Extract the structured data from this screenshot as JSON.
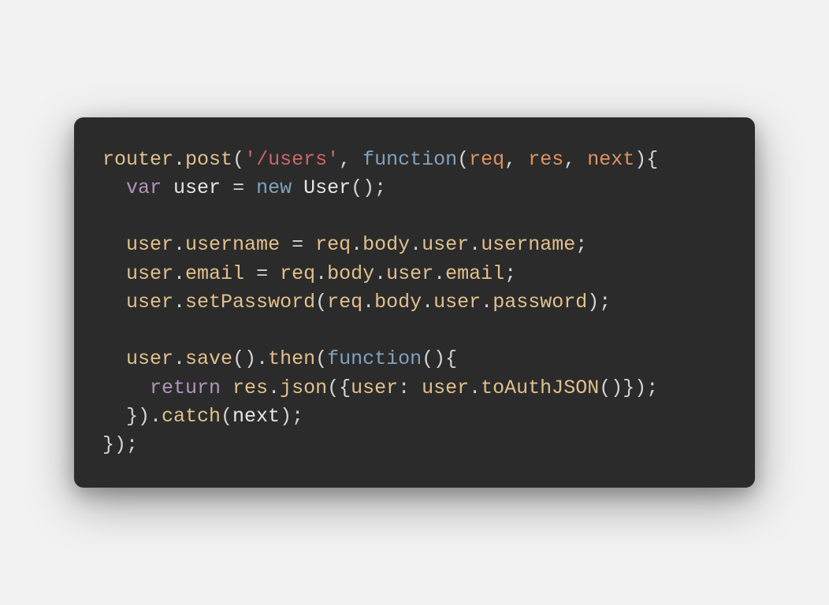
{
  "code": {
    "tokens": [
      [
        {
          "t": "router",
          "c": "tok-object"
        },
        {
          "t": ".",
          "c": "tok-punct"
        },
        {
          "t": "post",
          "c": "tok-method"
        },
        {
          "t": "(",
          "c": "tok-punct"
        },
        {
          "t": "'/users'",
          "c": "tok-string"
        },
        {
          "t": ", ",
          "c": "tok-punct"
        },
        {
          "t": "function",
          "c": "tok-keyword"
        },
        {
          "t": "(",
          "c": "tok-punct"
        },
        {
          "t": "req",
          "c": "tok-param"
        },
        {
          "t": ", ",
          "c": "tok-punct"
        },
        {
          "t": "res",
          "c": "tok-param"
        },
        {
          "t": ", ",
          "c": "tok-punct"
        },
        {
          "t": "next",
          "c": "tok-param"
        },
        {
          "t": "){",
          "c": "tok-punct"
        }
      ],
      [
        {
          "t": "  ",
          "c": "tok-punct"
        },
        {
          "t": "var",
          "c": "tok-var"
        },
        {
          "t": " ",
          "c": "tok-punct"
        },
        {
          "t": "user",
          "c": "tok-ident"
        },
        {
          "t": " = ",
          "c": "tok-punct"
        },
        {
          "t": "new",
          "c": "tok-newkw"
        },
        {
          "t": " ",
          "c": "tok-punct"
        },
        {
          "t": "User",
          "c": "tok-class"
        },
        {
          "t": "();",
          "c": "tok-punct"
        }
      ],
      [
        {
          "t": "",
          "c": "tok-punct"
        }
      ],
      [
        {
          "t": "  ",
          "c": "tok-punct"
        },
        {
          "t": "user",
          "c": "tok-object"
        },
        {
          "t": ".",
          "c": "tok-punct"
        },
        {
          "t": "username",
          "c": "tok-prop"
        },
        {
          "t": " = ",
          "c": "tok-punct"
        },
        {
          "t": "req",
          "c": "tok-object"
        },
        {
          "t": ".",
          "c": "tok-punct"
        },
        {
          "t": "body",
          "c": "tok-prop"
        },
        {
          "t": ".",
          "c": "tok-punct"
        },
        {
          "t": "user",
          "c": "tok-prop"
        },
        {
          "t": ".",
          "c": "tok-punct"
        },
        {
          "t": "username",
          "c": "tok-prop"
        },
        {
          "t": ";",
          "c": "tok-punct"
        }
      ],
      [
        {
          "t": "  ",
          "c": "tok-punct"
        },
        {
          "t": "user",
          "c": "tok-object"
        },
        {
          "t": ".",
          "c": "tok-punct"
        },
        {
          "t": "email",
          "c": "tok-prop"
        },
        {
          "t": " = ",
          "c": "tok-punct"
        },
        {
          "t": "req",
          "c": "tok-object"
        },
        {
          "t": ".",
          "c": "tok-punct"
        },
        {
          "t": "body",
          "c": "tok-prop"
        },
        {
          "t": ".",
          "c": "tok-punct"
        },
        {
          "t": "user",
          "c": "tok-prop"
        },
        {
          "t": ".",
          "c": "tok-punct"
        },
        {
          "t": "email",
          "c": "tok-prop"
        },
        {
          "t": ";",
          "c": "tok-punct"
        }
      ],
      [
        {
          "t": "  ",
          "c": "tok-punct"
        },
        {
          "t": "user",
          "c": "tok-object"
        },
        {
          "t": ".",
          "c": "tok-punct"
        },
        {
          "t": "setPassword",
          "c": "tok-method"
        },
        {
          "t": "(",
          "c": "tok-punct"
        },
        {
          "t": "req",
          "c": "tok-object"
        },
        {
          "t": ".",
          "c": "tok-punct"
        },
        {
          "t": "body",
          "c": "tok-prop"
        },
        {
          "t": ".",
          "c": "tok-punct"
        },
        {
          "t": "user",
          "c": "tok-prop"
        },
        {
          "t": ".",
          "c": "tok-punct"
        },
        {
          "t": "password",
          "c": "tok-prop"
        },
        {
          "t": ");",
          "c": "tok-punct"
        }
      ],
      [
        {
          "t": "",
          "c": "tok-punct"
        }
      ],
      [
        {
          "t": "  ",
          "c": "tok-punct"
        },
        {
          "t": "user",
          "c": "tok-object"
        },
        {
          "t": ".",
          "c": "tok-punct"
        },
        {
          "t": "save",
          "c": "tok-method"
        },
        {
          "t": "().",
          "c": "tok-punct"
        },
        {
          "t": "then",
          "c": "tok-method"
        },
        {
          "t": "(",
          "c": "tok-punct"
        },
        {
          "t": "function",
          "c": "tok-keyword"
        },
        {
          "t": "(){",
          "c": "tok-punct"
        }
      ],
      [
        {
          "t": "    ",
          "c": "tok-punct"
        },
        {
          "t": "return",
          "c": "tok-return"
        },
        {
          "t": " ",
          "c": "tok-punct"
        },
        {
          "t": "res",
          "c": "tok-object"
        },
        {
          "t": ".",
          "c": "tok-punct"
        },
        {
          "t": "json",
          "c": "tok-method"
        },
        {
          "t": "({",
          "c": "tok-punct"
        },
        {
          "t": "user",
          "c": "tok-prop"
        },
        {
          "t": ": ",
          "c": "tok-punct"
        },
        {
          "t": "user",
          "c": "tok-object"
        },
        {
          "t": ".",
          "c": "tok-punct"
        },
        {
          "t": "toAuthJSON",
          "c": "tok-method"
        },
        {
          "t": "()});",
          "c": "tok-punct"
        }
      ],
      [
        {
          "t": "  }).",
          "c": "tok-punct"
        },
        {
          "t": "catch",
          "c": "tok-method"
        },
        {
          "t": "(",
          "c": "tok-punct"
        },
        {
          "t": "next",
          "c": "tok-ident"
        },
        {
          "t": ");",
          "c": "tok-punct"
        }
      ],
      [
        {
          "t": "});",
          "c": "tok-punct"
        }
      ]
    ]
  }
}
